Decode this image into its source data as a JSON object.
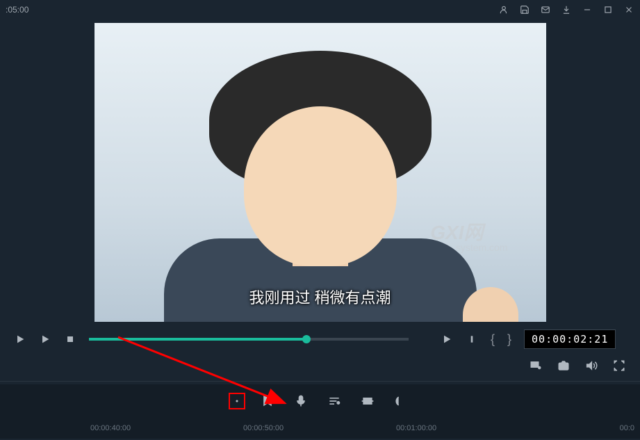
{
  "titlebar": {
    "time_left": ":05:00"
  },
  "preview": {
    "subtitle": "我刚用过 稍微有点潮",
    "watermark_main": "GXI网",
    "watermark_sub": "system.com"
  },
  "playback": {
    "timecode": "00:00:02:21"
  },
  "ruler": {
    "marks": [
      "00:00:40:00",
      "00:00:50:00",
      "00:01:00:00",
      "00:0"
    ]
  }
}
